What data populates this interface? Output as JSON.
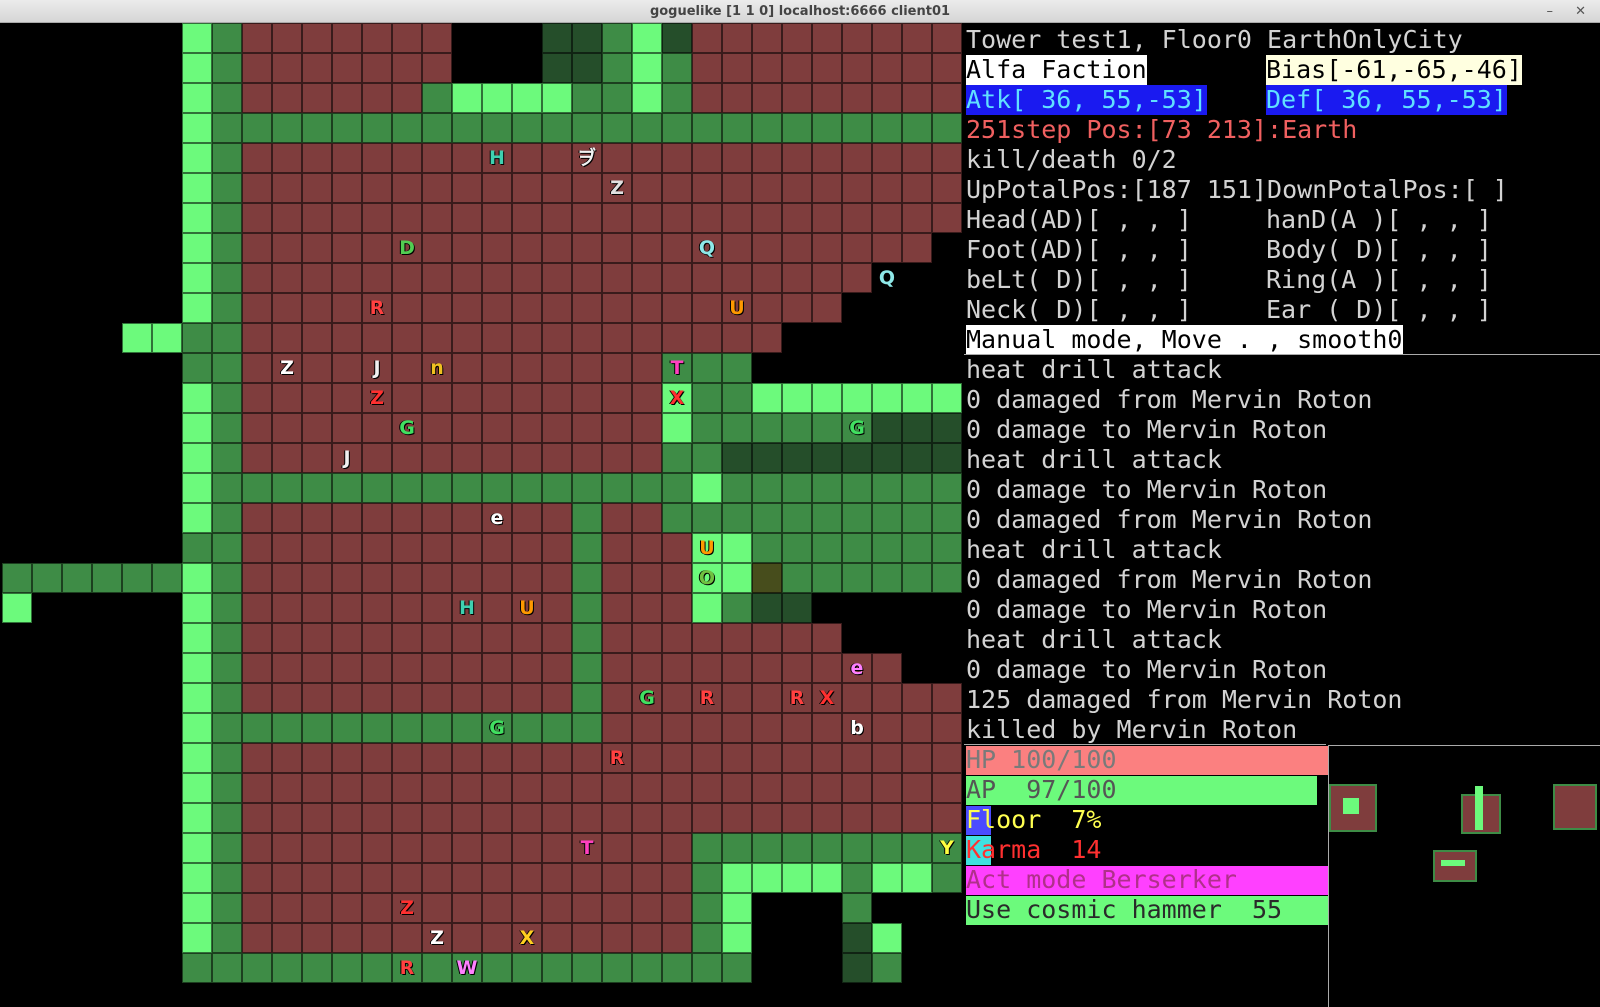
{
  "window": {
    "title": "goguelike [1 1 0] localhost:6666 client01",
    "min_glyph": "–",
    "close_glyph": "✕"
  },
  "map": {
    "cols": 32,
    "rows": 33,
    "rows_data": [
      "KKKKKKlwfffffffKKKddwldfffffffff",
      "KKKKKKlwfffffffKKKddwlwfffffffff",
      "KKKKKKlwffffffwllllwwlwfffffffff",
      "KKKKKKlwwwwwwwwwwwwwwwwwwwwwwwww",
      "KKKKKKlwffffffffffffffffffffffff",
      "KKKKKKlwffffffffffffffffffffffff",
      "KKKKKKlwffffffffffffffffffffffff",
      "KKKKKKlwfffffffffffffffffffffffK",
      "KKKKKKlwfffffffffffffffffffffKKK",
      "KKKKKKlwffffffffffffffffffffKKKK",
      "KKKKllwwffffffffffffffffffKKKKKK",
      "KKKKKKwwffffffffffffffwwwKKKKKKK",
      "KKKKKKlwfffffffffffffflwwlllllll",
      "KKKKKKlwfffffffffffffflwwwwwwddd",
      "KKKKKKlwffffffffffffffwwdddddddd",
      "KKKKKKlwwwwwwwwwwwwwwwwlwwwwwwww",
      "KKKKKKlwfffffffffffwffwwwwwwwwww",
      "KKKKKKwwfffffffffffwfffllwwwwwww",
      "wwwwwwlwfffffffffffwfffloWwwwwww",
      "lKKKKKlwfffffffffffwffflwddKKKKK",
      "KKKKKKlwfffffffffffwffffffffKKKK",
      "KKKKKKlwfffffffffffwffffffffffKK",
      "KKKKKKlwfffffffffffwffffffffffff",
      "KKKKKKlwwwwwwwwwwwwwffffffffffff",
      "KKKKKKlwffffffffffffffffffffffff",
      "KKKKKKlwffffffffffffffffffffffff",
      "KKKKKKlwffffffffffffffffffffffff",
      "KKKKKKlwfffffffffffffffwwwwwwwww",
      "KKKKKKlwfffffffffffffffwllllwllw",
      "KKKKKKlwfffffffffffffffwlKKKwKKK",
      "KKKKKKlwfffffffffffffffwlKKKdlKK",
      "KKKKKKwwwwwwwwwwwwwwwwwwwKKKdwKK",
      "KKKKKKKKKKKKKKKKKKKKKKKKKKKKKKKK"
    ],
    "mobs": [
      {
        "ch": "H",
        "col": 16,
        "row": 4,
        "color": "#3fd0b0"
      },
      {
        "ch": "ヺ",
        "col": 19,
        "row": 4,
        "color": "#f2f2f2"
      },
      {
        "ch": "Z",
        "col": 20,
        "row": 5,
        "color": "#e0e0e0"
      },
      {
        "ch": "D",
        "col": 13,
        "row": 7,
        "color": "#52cc52"
      },
      {
        "ch": "Q",
        "col": 23,
        "row": 7,
        "color": "#8ee8e8"
      },
      {
        "ch": "Q",
        "col": 29,
        "row": 8,
        "color": "#8ee8e8"
      },
      {
        "ch": "R",
        "col": 12,
        "row": 9,
        "color": "#ff4040"
      },
      {
        "ch": "U",
        "col": 24,
        "row": 9,
        "color": "#ff9900"
      },
      {
        "ch": "Z",
        "col": 9,
        "row": 11,
        "color": "#ffffff"
      },
      {
        "ch": "J",
        "col": 12,
        "row": 11,
        "color": "#f0f0f0"
      },
      {
        "ch": "n",
        "col": 14,
        "row": 11,
        "color": "#f0c020"
      },
      {
        "ch": "T",
        "col": 22,
        "row": 11,
        "color": "#ff40c0"
      },
      {
        "ch": "Z",
        "col": 12,
        "row": 12,
        "color": "#ff3030"
      },
      {
        "ch": "X",
        "col": 22,
        "row": 12,
        "color": "#ff3030"
      },
      {
        "ch": "G",
        "col": 13,
        "row": 13,
        "color": "#40e060"
      },
      {
        "ch": "G",
        "col": 28,
        "row": 13,
        "color": "#40e060"
      },
      {
        "ch": "J",
        "col": 11,
        "row": 14,
        "color": "#f0f0f0"
      },
      {
        "ch": "e",
        "col": 16,
        "row": 16,
        "color": "#ffffff"
      },
      {
        "ch": "U",
        "col": 23,
        "row": 17,
        "color": "#ff9900"
      },
      {
        "ch": "H",
        "col": 15,
        "row": 19,
        "color": "#3fd0b0"
      },
      {
        "ch": "U",
        "col": 17,
        "row": 19,
        "color": "#ff9900"
      },
      {
        "ch": "O",
        "col": 23,
        "row": 18,
        "color": "#70c040"
      },
      {
        "ch": "e",
        "col": 28,
        "row": 21,
        "color": "#ff80ff"
      },
      {
        "ch": "G",
        "col": 21,
        "row": 22,
        "color": "#40e060"
      },
      {
        "ch": "R",
        "col": 23,
        "row": 22,
        "color": "#ff4040"
      },
      {
        "ch": "R",
        "col": 26,
        "row": 22,
        "color": "#ff4040"
      },
      {
        "ch": "X",
        "col": 27,
        "row": 22,
        "color": "#ff3030"
      },
      {
        "ch": "G",
        "col": 16,
        "row": 23,
        "color": "#40e060"
      },
      {
        "ch": "b",
        "col": 28,
        "row": 23,
        "color": "#ffffff"
      },
      {
        "ch": "R",
        "col": 20,
        "row": 24,
        "color": "#ff4040"
      },
      {
        "ch": "T",
        "col": 19,
        "row": 27,
        "color": "#ff40c0"
      },
      {
        "ch": "Y",
        "col": 31,
        "row": 27,
        "color": "#ffff40"
      },
      {
        "ch": "Z",
        "col": 13,
        "row": 29,
        "color": "#ff3030"
      },
      {
        "ch": "Z",
        "col": 14,
        "row": 30,
        "color": "#ffffff"
      },
      {
        "ch": "X",
        "col": 17,
        "row": 30,
        "color": "#ffd020"
      },
      {
        "ch": "R",
        "col": 13,
        "row": 31,
        "color": "#ff4040"
      },
      {
        "ch": "W",
        "col": 15,
        "row": 31,
        "color": "#ff80ff"
      }
    ]
  },
  "status": {
    "tower_line": "Tower test1, Floor0 EarthOnlyCity",
    "faction": "Alfa Faction",
    "bias": "Bias[-61,-65,-46]",
    "atk": "Atk[ 36, 55,-53]",
    "def": "Def[ 36, 55,-53]",
    "step_pos": "251step Pos:[73 213]:Earth",
    "kill_death": "kill/death 0/2",
    "portal_pos": "UpPotalPos:[187 151]DownPotalPos:[ ]",
    "eq_head": "Head(AD)[ , , ]",
    "eq_hand": "hanD(A )[ , , ]",
    "eq_foot": "Foot(AD)[ , , ]",
    "eq_body": "Body( D)[ , , ]",
    "eq_belt": "beLt( D)[ , , ]",
    "eq_ring": "Ring(A )[ , , ]",
    "eq_neck": "Neck( D)[ , , ]",
    "eq_ear": "Ear ( D)[ , , ]",
    "mode": "Manual mode, Move . , smooth0"
  },
  "log": [
    "heat drill attack",
    "0 damaged from Mervin Roton",
    "0 damage to Mervin Roton",
    "heat drill attack",
    "0 damage to Mervin Roton",
    "0 damaged from Mervin Roton",
    "heat drill attack",
    "0 damaged from Mervin Roton",
    "0 damage to Mervin Roton",
    "heat drill attack",
    "0 damage to Mervin Roton",
    "125 damaged from Mervin Roton",
    "killed by Mervin Roton"
  ],
  "bars": {
    "hp": {
      "label": "HP 100/100",
      "fraction": 1.0,
      "color": "#fb8080",
      "text_color": "#7a7a7a"
    },
    "ap": {
      "label": "AP  97/100",
      "fraction": 0.97,
      "color": "#6cfa7c",
      "text_color": "#555555"
    },
    "floor": {
      "label": "Floor  7%",
      "fraction": 0.07,
      "color": "#4b4bff",
      "text_color": "#ffff50"
    },
    "karma": {
      "label": "Karma  14",
      "fraction": 0.07,
      "color": "#40e0e0",
      "text_color": "#ff3030"
    },
    "act": {
      "label": "Act mode Berserker",
      "fraction": 1.0,
      "color": "#ff40ff",
      "text_color": "#b0308a"
    },
    "use": {
      "label": "Use cosmic hammer  55",
      "fraction": 1.0,
      "color": "#6cfa7c",
      "text_color": "#2a2a2a"
    }
  },
  "colors": {
    "floor_tile": "#7f3d3d",
    "wall_dark": "#3e8c46",
    "wall_light": "#6cfa7c",
    "wall_shadow": "#254e2a",
    "step_color": "#f06060",
    "faction_bg": "#ffffff",
    "bias_bg": "#ffffe0",
    "atk_bg": "#1a1af0",
    "atk_fg": "#60e0ff"
  }
}
